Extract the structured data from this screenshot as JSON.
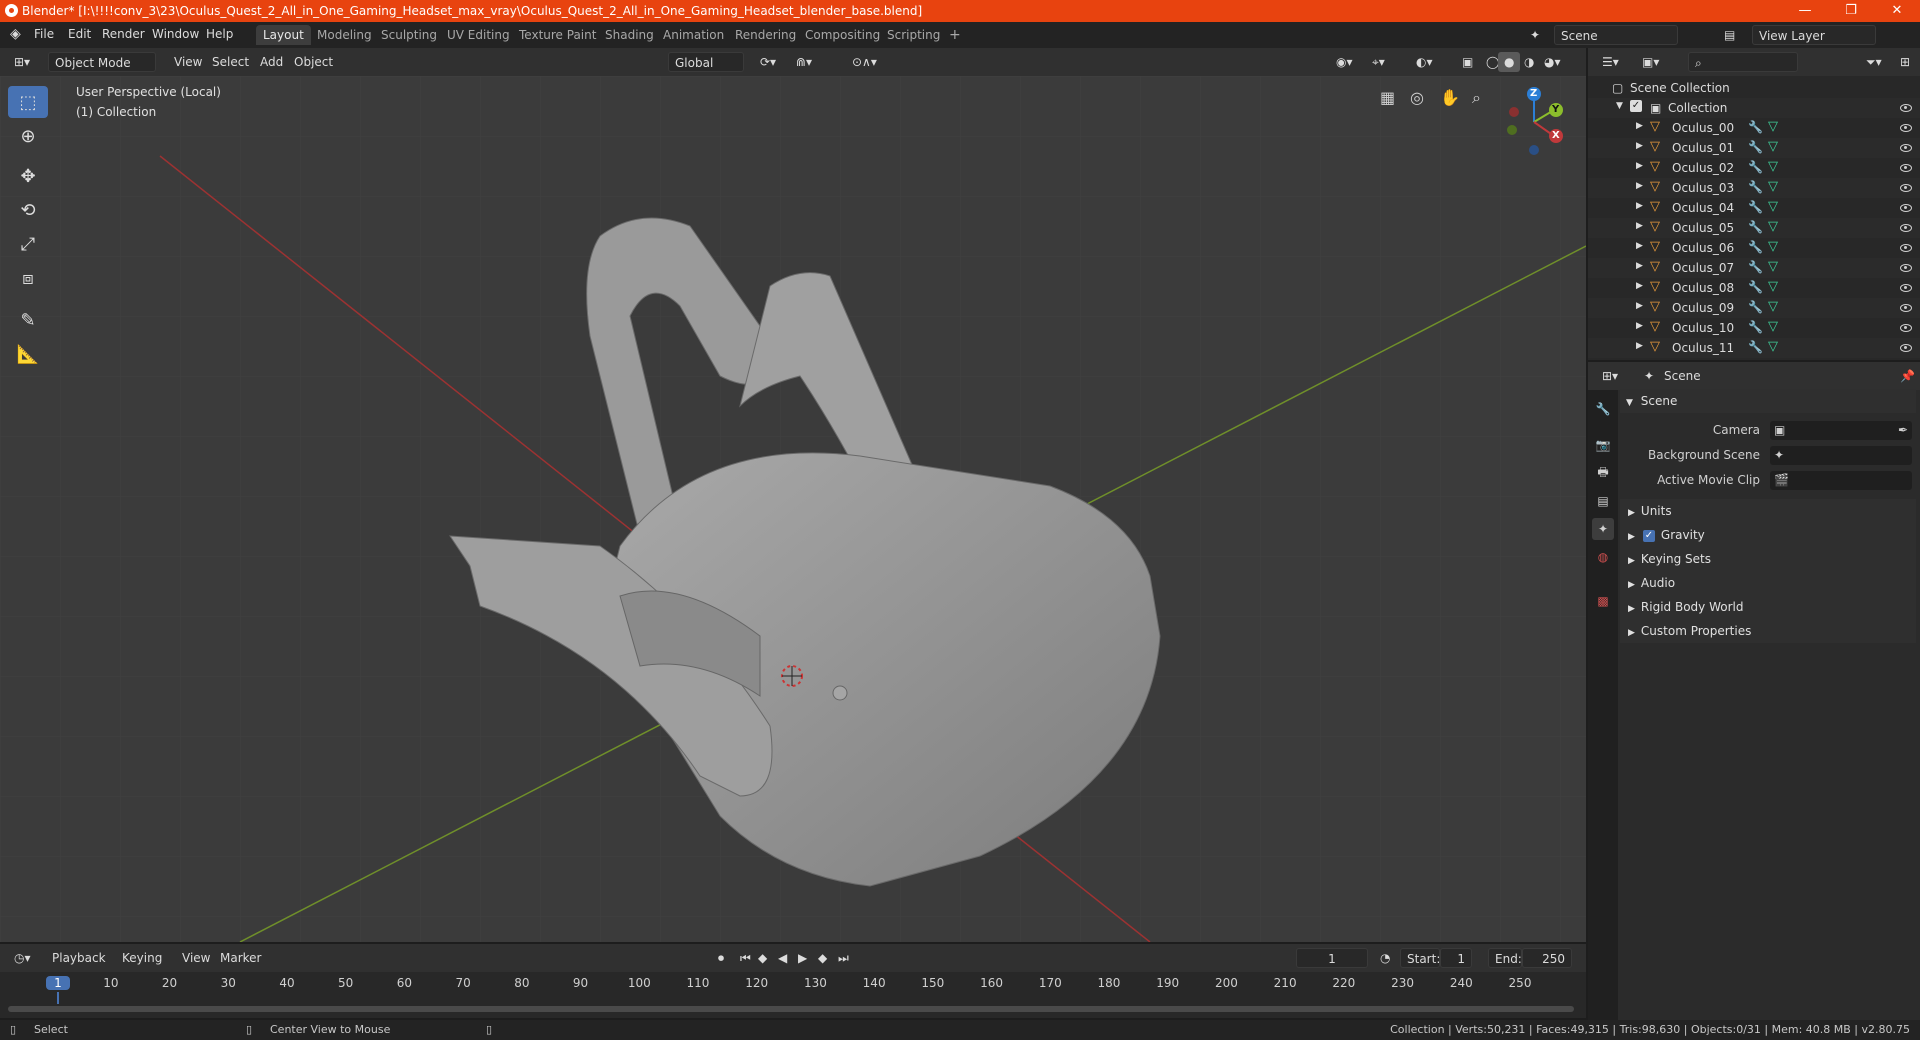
{
  "window": {
    "title": "Blender* [I:\\!!!!conv_3\\23\\Oculus_Quest_2_All_in_One_Gaming_Headset_max_vray\\Oculus_Quest_2_All_in_One_Gaming_Headset_blender_base.blend]",
    "minimize": "—",
    "maximize": "❐",
    "close": "✕"
  },
  "menu": [
    "File",
    "Edit",
    "Render",
    "Window",
    "Help"
  ],
  "workspaces": [
    "Layout",
    "Modeling",
    "Sculpting",
    "UV Editing",
    "Texture Paint",
    "Shading",
    "Animation",
    "Rendering",
    "Compositing",
    "Scripting"
  ],
  "workspace_add": "+",
  "scene": {
    "name": "Scene",
    "view_layer": "View Layer"
  },
  "viewport_header": {
    "mode": "Object Mode",
    "menus": [
      "View",
      "Select",
      "Add",
      "Object"
    ],
    "transform": "Global"
  },
  "viewport": {
    "perspective": "User Perspective (Local)",
    "collection": "(1) Collection",
    "gizmo": {
      "x": "X",
      "y": "Y",
      "z": "Z"
    }
  },
  "outliner": {
    "root": "Scene Collection",
    "collection": "Collection",
    "items": [
      "Oculus_00",
      "Oculus_01",
      "Oculus_02",
      "Oculus_03",
      "Oculus_04",
      "Oculus_05",
      "Oculus_06",
      "Oculus_07",
      "Oculus_08",
      "Oculus_09",
      "Oculus_10",
      "Oculus_11"
    ]
  },
  "properties": {
    "context": "Scene",
    "panel": "Scene",
    "fields": [
      {
        "label": "Camera"
      },
      {
        "label": "Background Scene"
      },
      {
        "label": "Active Movie Clip"
      }
    ],
    "sections": [
      "Units",
      "Gravity",
      "Keying Sets",
      "Audio",
      "Rigid Body World",
      "Custom Properties"
    ]
  },
  "timeline": {
    "menus": [
      "Playback",
      "Keying",
      "View",
      "Marker"
    ],
    "current_frame": "1",
    "start_label": "Start:",
    "start": "1",
    "end_label": "End:",
    "end": "250",
    "ticks": [
      "1",
      "10",
      "20",
      "30",
      "40",
      "50",
      "60",
      "70",
      "80",
      "90",
      "100",
      "110",
      "120",
      "130",
      "140",
      "150",
      "160",
      "170",
      "180",
      "190",
      "200",
      "210",
      "220",
      "230",
      "240",
      "250"
    ]
  },
  "status": {
    "select": "Select",
    "center": "Center View to Mouse",
    "stats": "Collection | Verts:50,231 | Faces:49,315 | Tris:98,630 | Objects:0/31 | Mem: 40.8 MB | v2.80.75"
  },
  "colors": {
    "accent": "#4772b3",
    "titlebar": "#e8430f",
    "x_axis": "#c0393b",
    "y_axis": "#8cbd2c",
    "z_axis": "#2c7fd6"
  }
}
